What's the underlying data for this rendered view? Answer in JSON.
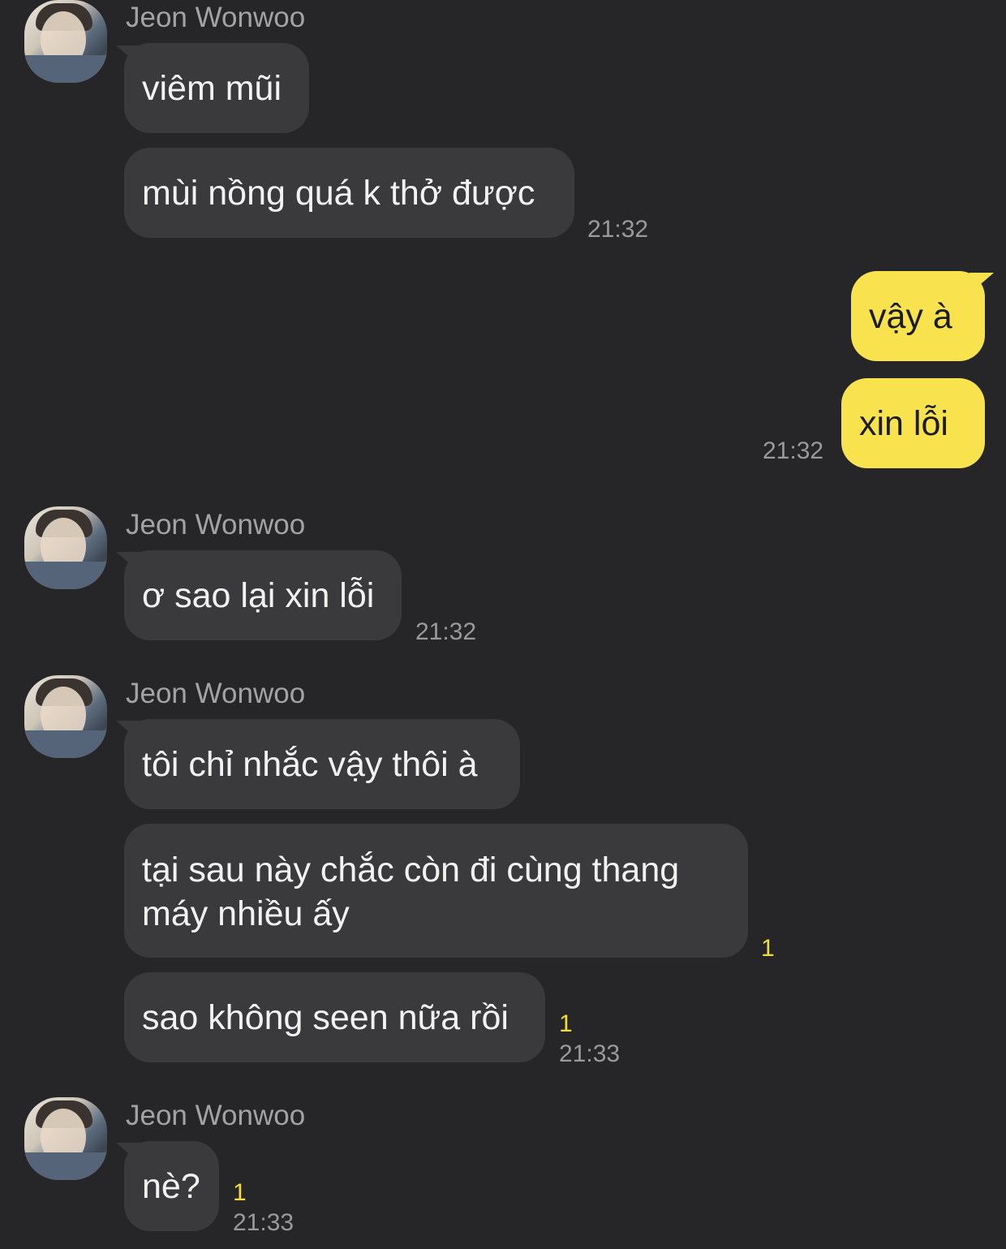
{
  "contact_name": "Jeon Wonwoo",
  "messages": [
    {
      "text": "viêm mũi"
    },
    {
      "text": "mùi nồng quá k thở được",
      "time": "21:32"
    },
    {
      "text": "vậy à"
    },
    {
      "text": "xin lỗi",
      "time": "21:32"
    },
    {
      "text": "ơ sao lại xin lỗi",
      "time": "21:32"
    },
    {
      "text": "tôi chỉ nhắc vậy thôi à"
    },
    {
      "text": "tại sau này chắc còn đi cùng thang máy nhiều ấy",
      "unread": "1"
    },
    {
      "text": "sao không seen nữa rồi",
      "unread": "1",
      "time": "21:33"
    },
    {
      "text": "nè?",
      "unread": "1",
      "time": "21:33"
    }
  ],
  "colors": {
    "background": "#262628",
    "incoming_bubble": "#3a3a3c",
    "outgoing_bubble": "#f8e24d",
    "unread_count": "#f3dc3c"
  },
  "icons": {
    "avatar": "profile-photo-avatar"
  }
}
